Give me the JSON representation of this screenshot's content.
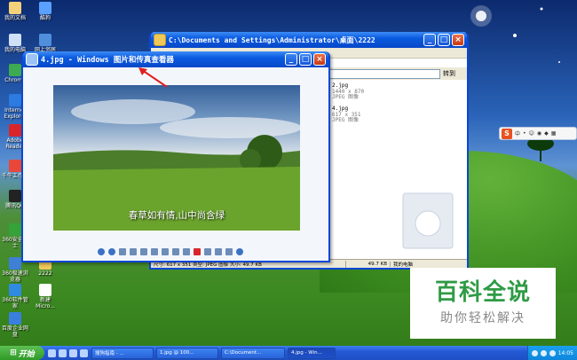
{
  "desktop": {
    "icons": [
      {
        "label": "我的文档",
        "icon": "my-documents-icon",
        "color": "#f3d27a"
      },
      {
        "label": "酷狗",
        "icon": "kugou-icon",
        "color": "#5aa0ff"
      },
      {
        "label": "我的电脑",
        "icon": "my-computer-icon",
        "color": "#cfe0f7"
      },
      {
        "label": "网上邻居",
        "icon": "network-icon",
        "color": "#4f8fdc"
      },
      {
        "label": "Chrome",
        "icon": "chrome-icon",
        "color": "#3dab4f"
      },
      {
        "label": "Internet Explorer",
        "icon": "ie-icon",
        "color": "#2c7be0"
      },
      {
        "label": "Adobe Reader",
        "icon": "adobe-reader-icon",
        "color": "#d8262b"
      },
      {
        "label": "千牛工作台",
        "icon": "qianniu-icon",
        "color": "#e8473a"
      },
      {
        "label": "腾讯QQ",
        "icon": "qq-icon",
        "color": "#222222"
      },
      {
        "label": "360安全卫士",
        "icon": "360-safe-icon",
        "color": "#35a33a"
      },
      {
        "label": "360极速浏览器",
        "icon": "360-browser-icon",
        "color": "#3f7fd6"
      },
      {
        "label": "2222",
        "icon": "folder-icon",
        "color": "#f0c85a"
      },
      {
        "label": "360软件管家",
        "icon": "360-software-icon",
        "color": "#2f8ae0"
      },
      {
        "label": "新建 Micro...",
        "icon": "word-doc-icon",
        "color": "#ffffff"
      },
      {
        "label": "百度企业网盘",
        "icon": "baidu-pan-icon",
        "color": "#3a7fe0"
      }
    ]
  },
  "explorer": {
    "title": "C:\\Documents and Settings\\Administrator\\桌面\\2222",
    "address": "2222",
    "go_label": "转到",
    "files": [
      {
        "name": "2.jpg",
        "dims": "1440 x 870",
        "type": "JPEG 图像"
      },
      {
        "name": "4.jpg",
        "dims": "617 x 351",
        "type": "JPEG 图像"
      }
    ],
    "status": {
      "info": "尺寸: 617 x 351 类型: JPEG 图像 大小: 49.7 KB",
      "size": "49.7 KB",
      "zone": "我的电脑"
    }
  },
  "viewer": {
    "title": "4.jpg - Windows 图片和传真查看器",
    "caption": "春草如有情,山中尚含绿"
  },
  "watermark": {
    "title": "百科全说",
    "subtitle": "助你轻松解决"
  },
  "taskbar": {
    "start": "开始",
    "tasks": [
      {
        "label": "搜狗指南 - ...",
        "active": false
      },
      {
        "label": "1.jpg @ 100...",
        "active": false
      },
      {
        "label": "C:\\Document...",
        "active": false
      },
      {
        "label": "4.jpg - Win...",
        "active": true
      }
    ],
    "clock": "14:05"
  },
  "colors": {
    "titlebar": "#0a5ae0",
    "watermark_green": "#2f9b45",
    "close": "#c83a12"
  }
}
